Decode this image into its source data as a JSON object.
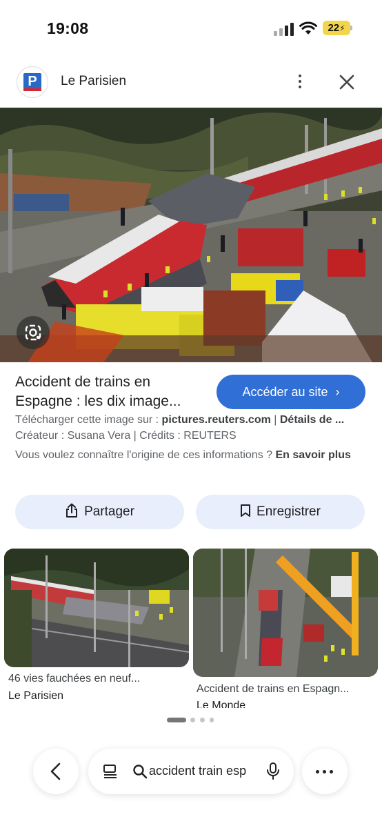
{
  "status_bar": {
    "time": "19:08",
    "battery": "22"
  },
  "header": {
    "site_name": "Le Parisien",
    "logo_letter": "P"
  },
  "result": {
    "title": "Accident de trains en Espagne : les dix image...",
    "visit_button": "Accéder au site",
    "download_prefix": "Télécharger cette image sur : ",
    "download_source": "pictures.reuters.com",
    "download_sep": " | ",
    "details_label": "Détails de ...",
    "credit_line": "Créateur : Susana Vera | Crédits : REUTERS",
    "origin_question": "Vous voulez connaître l'origine de ces informations ? ",
    "learn_more": "En savoir plus"
  },
  "actions": {
    "share": "Partager",
    "save": "Enregistrer"
  },
  "related": [
    {
      "caption": "46 vies fauchées en neuf...",
      "source": "Le Parisien"
    },
    {
      "caption": "Accident de trains en Espagn...",
      "source": "Le Monde"
    }
  ],
  "search": {
    "query": "accident train esp"
  },
  "colors": {
    "accent": "#2f6fd6",
    "pill": "#e8eefc",
    "brand_red": "#d8262e"
  },
  "icons": [
    "search-icon",
    "mic-icon",
    "lens-icon",
    "share-icon",
    "bookmark-icon",
    "close-icon",
    "back-icon",
    "more-icon",
    "list-icon"
  ]
}
